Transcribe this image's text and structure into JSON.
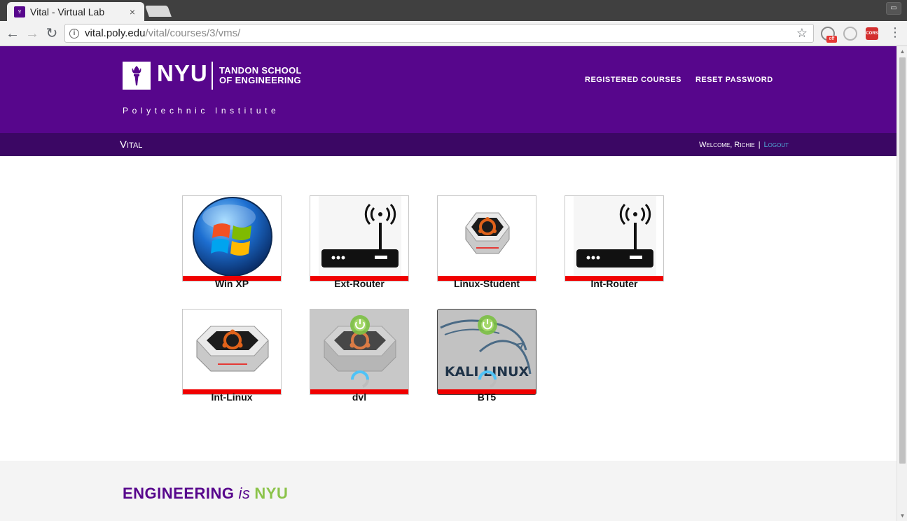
{
  "browser": {
    "tab_title": "Vital - Virtual Lab",
    "tab_close": "×",
    "url_host": "vital.poly.edu",
    "url_path": "/vital/courses/3/vms/",
    "ext1_badge": "off",
    "ext3_label": "CORS"
  },
  "header": {
    "logo_word": "NYU",
    "school_line1": "TANDON SCHOOL",
    "school_line2": "OF ENGINEERING",
    "institute": "Polytechnic Institute",
    "nav": [
      "REGISTERED COURSES",
      "RESET PASSWORD"
    ]
  },
  "subbar": {
    "title": "Vital",
    "welcome": "Welcome, Richie",
    "separator": "|",
    "logout": "Logout"
  },
  "vms": [
    {
      "name": "Win XP",
      "icon": "windows-icon",
      "status": "stopped"
    },
    {
      "name": "Ext-Router",
      "icon": "router-icon",
      "status": "stopped"
    },
    {
      "name": "Linux-Student",
      "icon": "ubuntu-drive-icon",
      "status": "stopped"
    },
    {
      "name": "Int-Router",
      "icon": "router-icon",
      "status": "stopped"
    },
    {
      "name": "Int-Linux",
      "icon": "ubuntu-drive-icon",
      "status": "stopped"
    },
    {
      "name": "dvl",
      "icon": "ubuntu-drive-icon",
      "status": "starting"
    },
    {
      "name": "BT5",
      "icon": "kali-linux-icon",
      "status": "starting",
      "image_text": "KALI LINUX"
    }
  ],
  "footer": {
    "tag_engineering": "ENGINEERING",
    "tag_is": "is",
    "tag_nyu": "NYU"
  },
  "colors": {
    "nyu_purple": "#57068c",
    "subbar_purple": "#3b0764",
    "status_red": "#f00000",
    "power_green": "#7bc043",
    "nyu_green": "#8bc34a"
  }
}
